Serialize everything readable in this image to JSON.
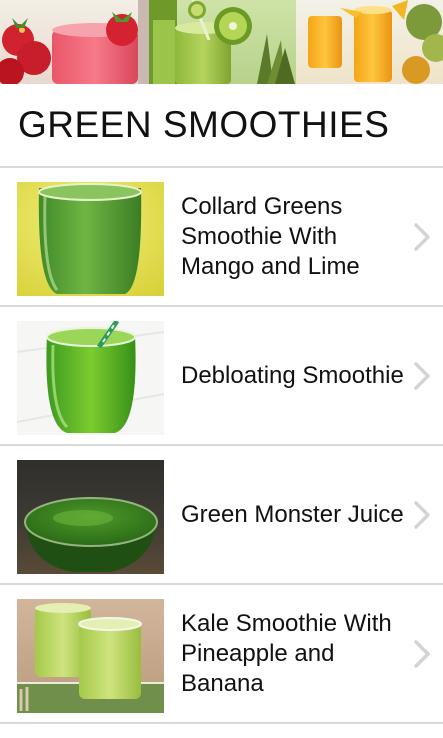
{
  "header": {
    "title": "GREEN SMOOTHIES"
  },
  "recipes": [
    {
      "title": "Collard Greens Smoothie With Mango and Lime"
    },
    {
      "title": "Debloating Smoothie"
    },
    {
      "title": "Green Monster Juice"
    },
    {
      "title": "Kale Smoothie With Pineapple and Banana"
    }
  ],
  "icons": {
    "chevron": "chevron-right-icon"
  },
  "colors": {
    "divider": "#d9d9d9",
    "chevron": "#d3d3d3",
    "title_text": "#111111"
  }
}
